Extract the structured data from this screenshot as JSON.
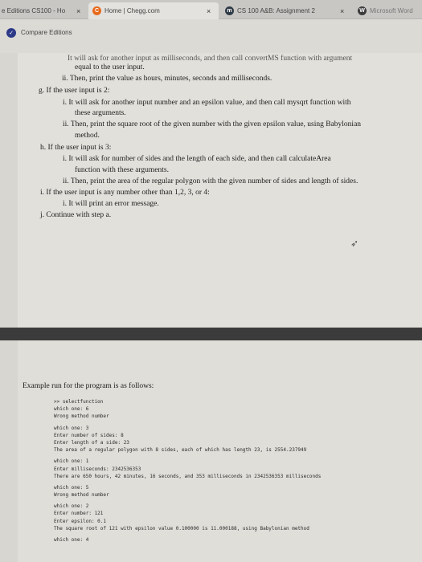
{
  "tabs": [
    {
      "title": "e Editions CS100 - Ho",
      "close": "×"
    },
    {
      "title": "Home | Chegg.com",
      "close": "×"
    },
    {
      "title": "CS 100 A&B: Assignment 2",
      "close": "×"
    },
    {
      "title": "Microsoft Word"
    }
  ],
  "toolbar": {
    "edition_label": "Compare Editions"
  },
  "doc1": {
    "partial_top": "It will ask for another input as milliseconds, and then call convertMS function with argument",
    "lines": [
      {
        "text": "equal to the user input."
      },
      {
        "text": "ii.  Then, print the value as hours, minutes, seconds and milliseconds."
      },
      {
        "text": "g.  If the user input is 2:"
      },
      {
        "text": "i.  It will ask for another input number and an epsilon value, and then call mysqrt function with"
      },
      {
        "text": "these arguments."
      },
      {
        "text": "ii.  Then, print the square root of the given number with the given epsilon value, using Babylonian"
      },
      {
        "text": "method."
      },
      {
        "text": "h.  If the user input is 3:"
      },
      {
        "text": "i.  It will ask for number of sides and the length of each side, and then call calculateArea"
      },
      {
        "text": "function with these arguments."
      },
      {
        "text": "ii.  Then, print the area of the regular polygon with the given number of sides and length of sides."
      },
      {
        "text": "i.  If the user input is any number other than 1,2, 3, or 4:"
      },
      {
        "text": "i.  It will print an error message."
      },
      {
        "text": "j.  Continue with step a."
      }
    ]
  },
  "doc2": {
    "heading": "Example run for the program is as follows:",
    "terminal": [
      ">> selectfunction",
      "which one: 6",
      "Wrong method number",
      "",
      "which one: 3",
      "Enter number of sides: 8",
      "Enter length of a side: 23",
      "The area of a regular polygon with 8 sides, each of which has length 23, is 2554.237949",
      "",
      "which one: 1",
      "Enter milliseconds: 2342536353",
      "There are 650 hours, 42 minutes, 16 seconds, and 353 milliseconds in 2342536353 milliseconds",
      "",
      "which one: 5",
      "Wrong method number",
      "",
      "which one: 2",
      "Enter number: 121",
      "Enter epsilon: 0.1",
      "The square root of 121 with epsilon value 0.100000 is 11.000188, using Babylonian method",
      "",
      "which one: 4"
    ]
  }
}
